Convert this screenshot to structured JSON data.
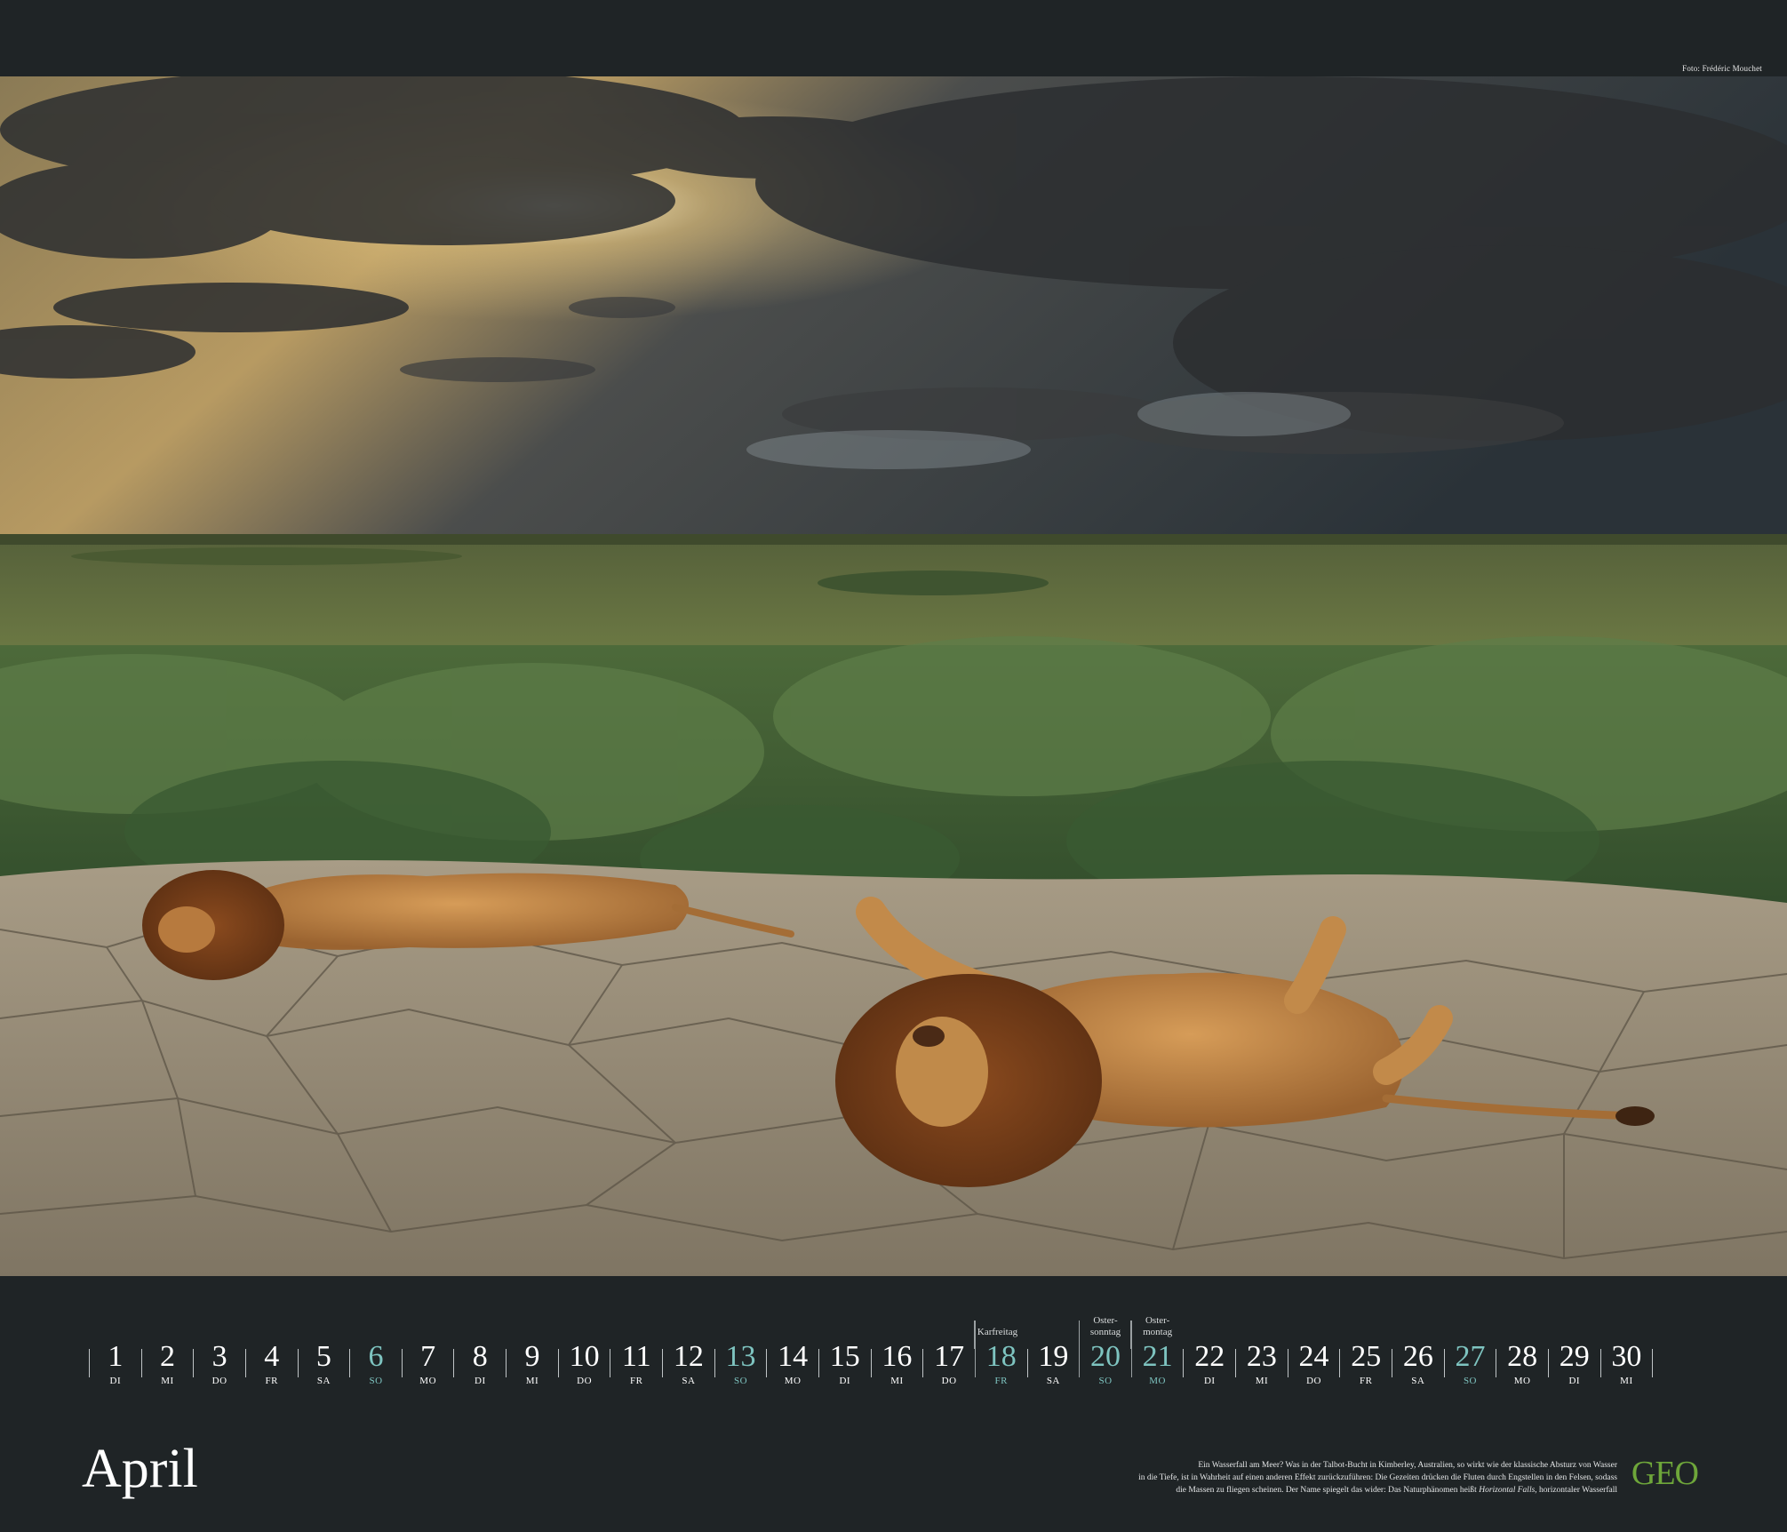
{
  "photo": {
    "credit": "Foto: Frédéric Mouchet",
    "subject": "lion-icon"
  },
  "month": "April",
  "calendar": {
    "days": [
      {
        "n": "1",
        "d": "DI",
        "sunday": false,
        "note": ""
      },
      {
        "n": "2",
        "d": "MI",
        "sunday": false,
        "note": ""
      },
      {
        "n": "3",
        "d": "DO",
        "sunday": false,
        "note": ""
      },
      {
        "n": "4",
        "d": "FR",
        "sunday": false,
        "note": ""
      },
      {
        "n": "5",
        "d": "SA",
        "sunday": false,
        "note": ""
      },
      {
        "n": "6",
        "d": "SO",
        "sunday": true,
        "note": ""
      },
      {
        "n": "7",
        "d": "MO",
        "sunday": false,
        "note": ""
      },
      {
        "n": "8",
        "d": "DI",
        "sunday": false,
        "note": ""
      },
      {
        "n": "9",
        "d": "MI",
        "sunday": false,
        "note": ""
      },
      {
        "n": "10",
        "d": "DO",
        "sunday": false,
        "note": ""
      },
      {
        "n": "11",
        "d": "FR",
        "sunday": false,
        "note": ""
      },
      {
        "n": "12",
        "d": "SA",
        "sunday": false,
        "note": ""
      },
      {
        "n": "13",
        "d": "SO",
        "sunday": true,
        "note": ""
      },
      {
        "n": "14",
        "d": "MO",
        "sunday": false,
        "note": ""
      },
      {
        "n": "15",
        "d": "DI",
        "sunday": false,
        "note": ""
      },
      {
        "n": "16",
        "d": "MI",
        "sunday": false,
        "note": ""
      },
      {
        "n": "17",
        "d": "DO",
        "sunday": false,
        "note": ""
      },
      {
        "n": "18",
        "d": "FR",
        "sunday": true,
        "note": "Karfreitag"
      },
      {
        "n": "19",
        "d": "SA",
        "sunday": false,
        "note": ""
      },
      {
        "n": "20",
        "d": "SO",
        "sunday": true,
        "note": "Oster-\nsonntag"
      },
      {
        "n": "21",
        "d": "MO",
        "sunday": true,
        "note": "Oster-\nmontag"
      },
      {
        "n": "22",
        "d": "DI",
        "sunday": false,
        "note": ""
      },
      {
        "n": "23",
        "d": "MI",
        "sunday": false,
        "note": ""
      },
      {
        "n": "24",
        "d": "DO",
        "sunday": false,
        "note": ""
      },
      {
        "n": "25",
        "d": "FR",
        "sunday": false,
        "note": ""
      },
      {
        "n": "26",
        "d": "SA",
        "sunday": false,
        "note": ""
      },
      {
        "n": "27",
        "d": "SO",
        "sunday": true,
        "note": ""
      },
      {
        "n": "28",
        "d": "MO",
        "sunday": false,
        "note": ""
      },
      {
        "n": "29",
        "d": "DI",
        "sunday": false,
        "note": ""
      },
      {
        "n": "30",
        "d": "MI",
        "sunday": false,
        "note": ""
      }
    ]
  },
  "caption": {
    "line1": "Ein Wasserfall am Meer? Was in der Talbot-Bucht in Kimberley, Australien, so wirkt wie der klassische Absturz von Wasser",
    "line2": "in die Tiefe, ist in Wahrheit auf einen anderen Effekt zurückzuführen: Die Gezeiten drücken die Fluten durch Engstellen in den Felsen, sodass",
    "line3a": "die Massen zu fliegen scheinen. Der Name spiegelt das wider: Das Naturphänomen heißt ",
    "line3em": "Horizontal Falls",
    "line3b": ", horizontaler Wasserfall"
  },
  "brand": {
    "logo": "GEO",
    "logo_color": "#6ea63a",
    "sunday_color": "#7ec4c0",
    "background": "#1f2426"
  }
}
